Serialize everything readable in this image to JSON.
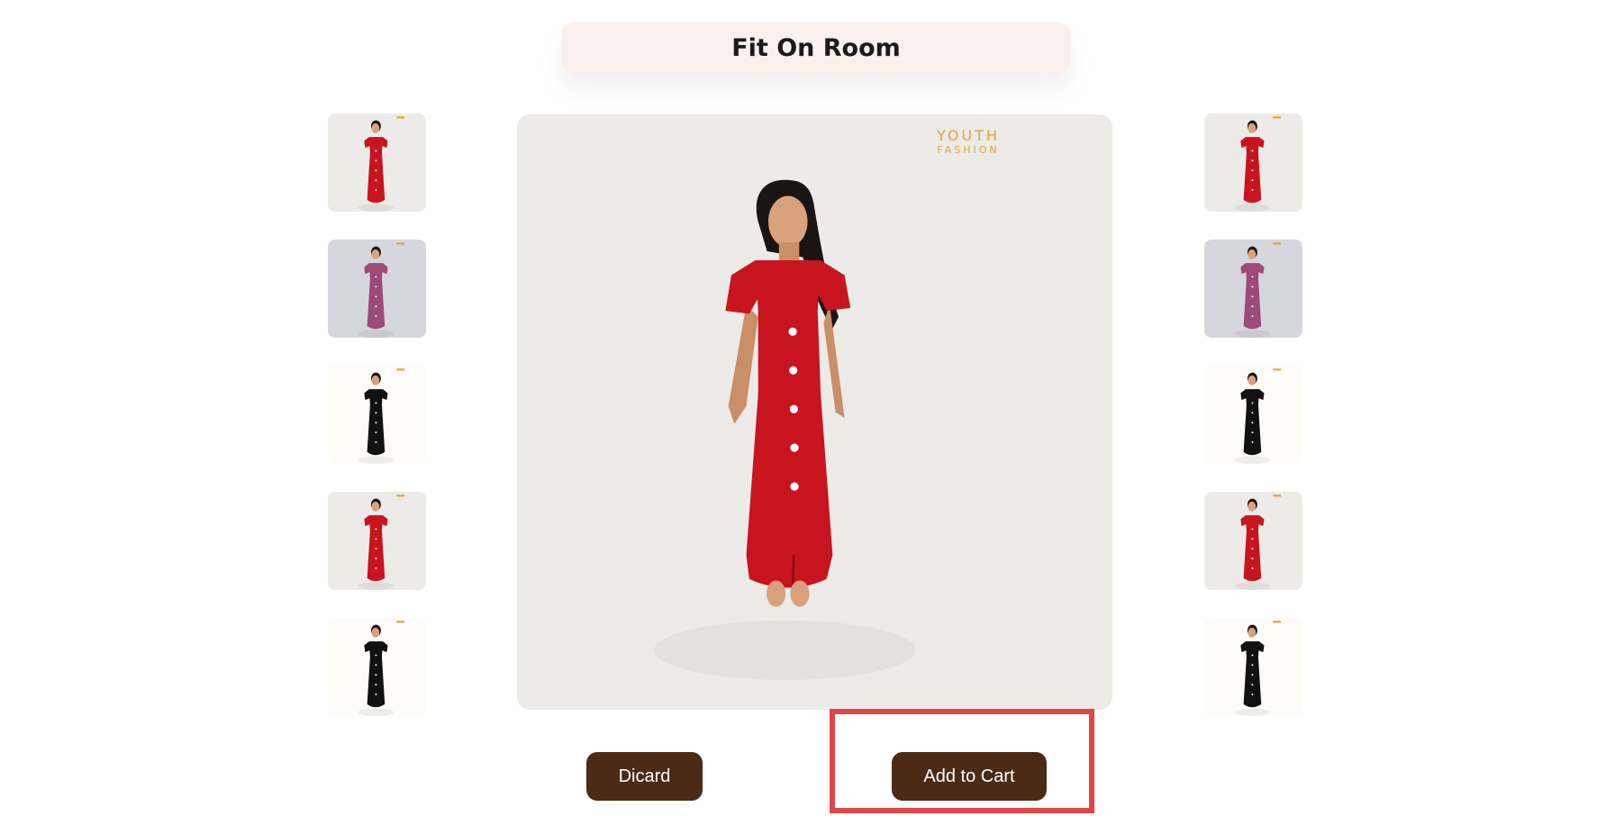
{
  "header": {
    "title": "Fit On Room"
  },
  "main_image": {
    "brand_line1": "YOUTH",
    "brand_line2": "FASHION",
    "dress_color": "#c8141f"
  },
  "thumbnails_left": [
    {
      "dress_color": "#c8141f",
      "bg": "#ecebe8"
    },
    {
      "dress_color": "#9c4a78",
      "bg": "#d6d6de"
    },
    {
      "dress_color": "#111111",
      "bg": "#fdfcf9"
    },
    {
      "dress_color": "#c8141f",
      "bg": "#ecebe8"
    },
    {
      "dress_color": "#111111",
      "bg": "#fdfcf9"
    }
  ],
  "thumbnails_right": [
    {
      "dress_color": "#c8141f",
      "bg": "#ecebe8"
    },
    {
      "dress_color": "#9c4a78",
      "bg": "#d6d6de"
    },
    {
      "dress_color": "#111111",
      "bg": "#fdfcf9"
    },
    {
      "dress_color": "#c8141f",
      "bg": "#ecebe8"
    },
    {
      "dress_color": "#111111",
      "bg": "#fdfcf9"
    }
  ],
  "actions": {
    "discard_label": "Dicard",
    "add_to_cart_label": "Add to Cart"
  },
  "colors": {
    "button_bg": "#4b2a16",
    "title_bg": "#faf1ec",
    "highlight": "#e24548"
  }
}
